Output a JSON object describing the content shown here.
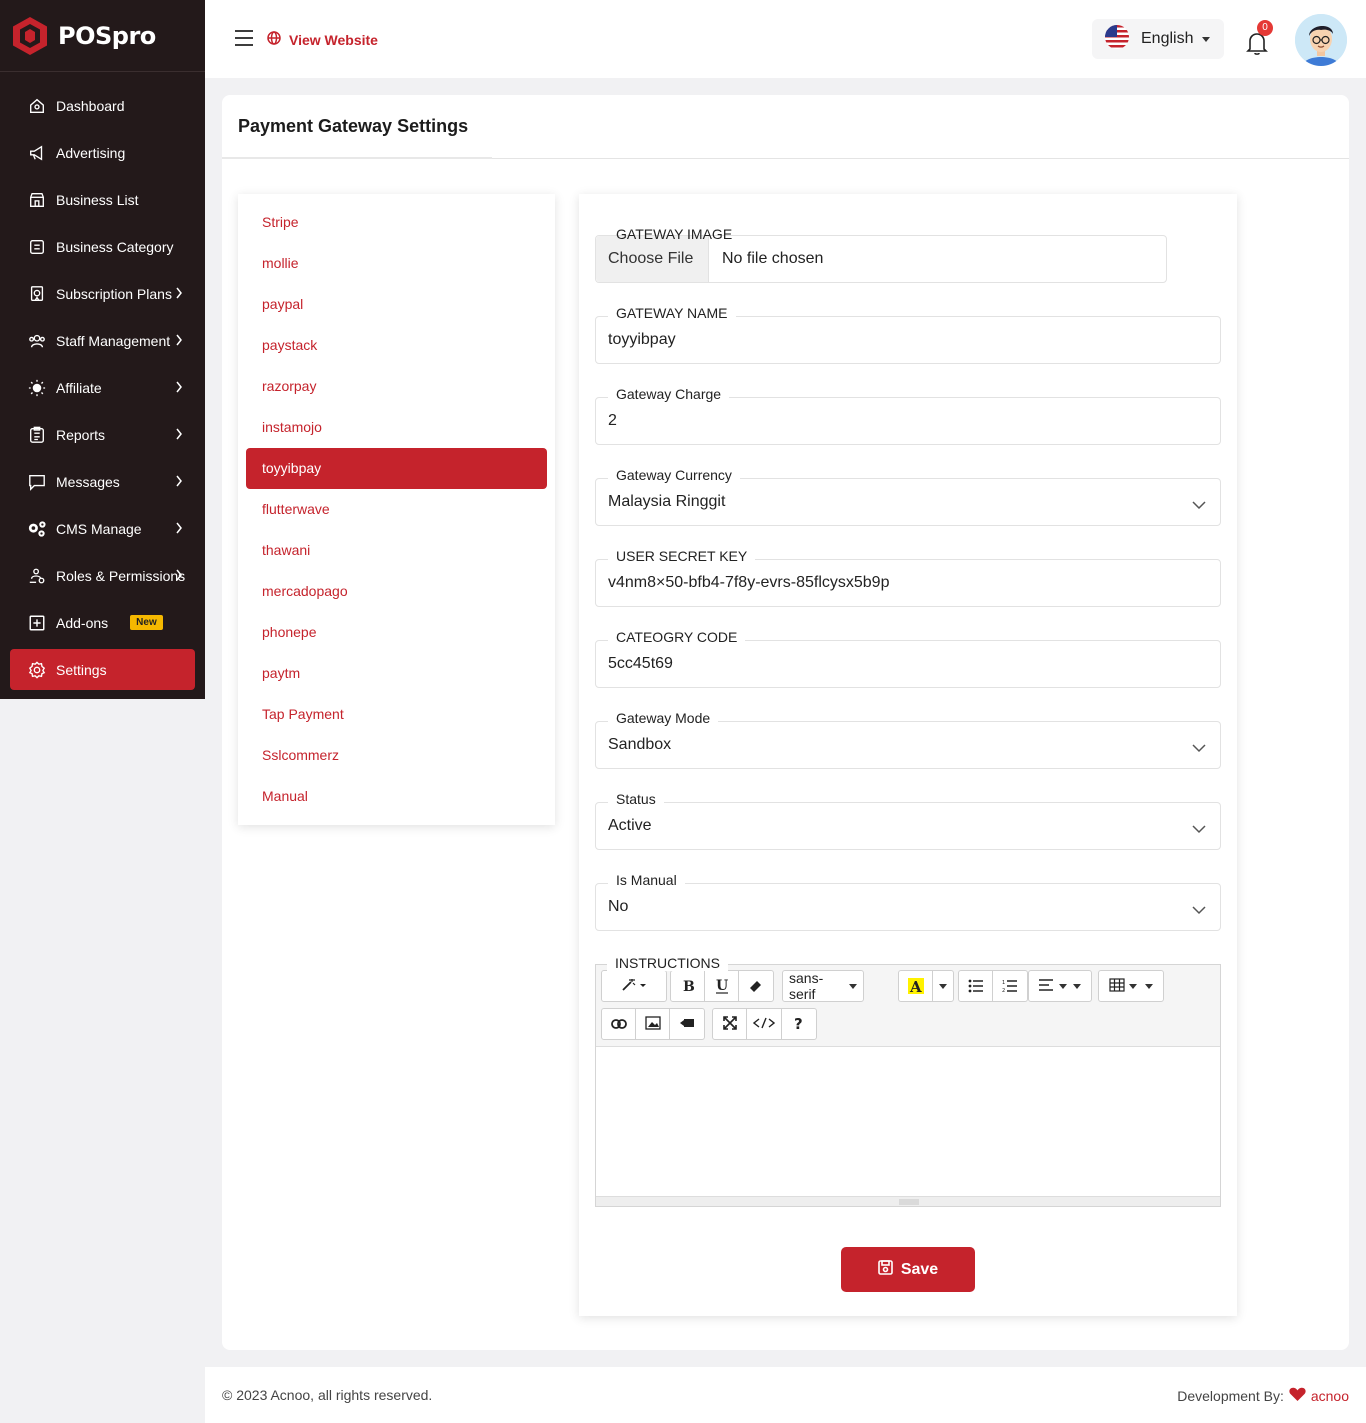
{
  "brand": {
    "name": "POSpro"
  },
  "sidebar": {
    "items": [
      {
        "label": "Dashboard",
        "icon": "home-icon",
        "has_chevron": false,
        "active": false
      },
      {
        "label": "Advertising",
        "icon": "megaphone-icon",
        "has_chevron": false,
        "active": false
      },
      {
        "label": "Business List",
        "icon": "store-icon",
        "has_chevron": false,
        "active": false
      },
      {
        "label": "Business Category",
        "icon": "category-icon",
        "has_chevron": false,
        "active": false
      },
      {
        "label": "Subscription Plans",
        "icon": "subscription-icon",
        "has_chevron": true,
        "active": false
      },
      {
        "label": "Staff Management",
        "icon": "staff-icon",
        "has_chevron": true,
        "active": false
      },
      {
        "label": "Affiliate",
        "icon": "affiliate-icon",
        "has_chevron": true,
        "active": false
      },
      {
        "label": "Reports",
        "icon": "reports-icon",
        "has_chevron": true,
        "active": false
      },
      {
        "label": "Messages",
        "icon": "message-icon",
        "has_chevron": true,
        "active": false
      },
      {
        "label": "CMS Manage",
        "icon": "gears-icon",
        "has_chevron": true,
        "active": false
      },
      {
        "label": "Roles & Permissions",
        "icon": "roles-icon",
        "has_chevron": true,
        "active": false
      },
      {
        "label": "Add-ons",
        "icon": "plus-square-icon",
        "has_chevron": false,
        "active": false,
        "badge": "New"
      },
      {
        "label": "Settings",
        "icon": "settings-icon",
        "has_chevron": false,
        "active": true
      }
    ]
  },
  "header": {
    "view_website": "View Website",
    "language": "English",
    "notification_count": "0"
  },
  "page": {
    "title": "Payment Gateway Settings"
  },
  "gateways": [
    "Stripe",
    "mollie",
    "paypal",
    "paystack",
    "razorpay",
    "instamojo",
    "toyyibpay",
    "flutterwave",
    "thawani",
    "mercadopago",
    "phonepe",
    "paytm",
    "Tap Payment",
    "Sslcommerz",
    "Manual"
  ],
  "active_gateway": "toyyibpay",
  "form": {
    "gateway_image": {
      "label": "GATEWAY IMAGE",
      "button": "Choose File",
      "status": "No file chosen"
    },
    "gateway_name": {
      "label": "GATEWAY NAME",
      "value": "toyyibpay"
    },
    "gateway_charge": {
      "label": "Gateway Charge",
      "value": "2"
    },
    "gateway_currency": {
      "label": "Gateway Currency",
      "value": "Malaysia Ringgit"
    },
    "user_secret_key": {
      "label": "USER SECRET KEY",
      "value": "v4nm8×50-bfb4-7f8y-evrs-85flcysx5b9p"
    },
    "category_code": {
      "label": "CATEOGRY CODE",
      "value": "5cc45t69"
    },
    "gateway_mode": {
      "label": "Gateway Mode",
      "value": "Sandbox"
    },
    "status": {
      "label": "Status",
      "value": "Active"
    },
    "is_manual": {
      "label": "Is Manual",
      "value": "No"
    },
    "instructions": {
      "label": "INSTRUCTIONS",
      "font": "sans-serif",
      "content": ""
    },
    "save_label": "Save"
  },
  "footer": {
    "copyright": "© 2023 Acnoo, all rights reserved.",
    "dev_label": "Development By:",
    "dev_brand": "acnoo"
  },
  "colors": {
    "accent": "#c5232c",
    "sidebar_bg": "#23191a",
    "badge": "#f5b800"
  }
}
